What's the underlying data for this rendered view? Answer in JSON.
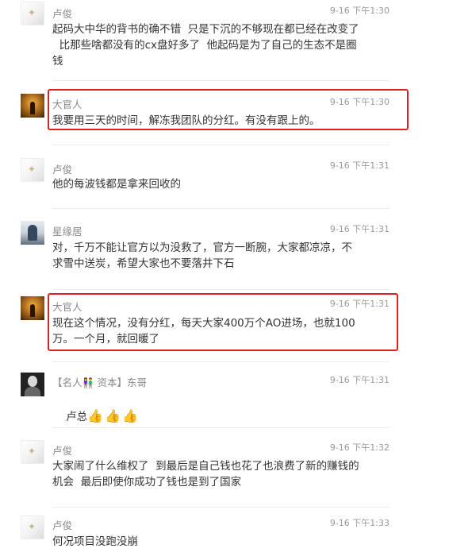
{
  "comments": [
    {
      "name": "卢俊",
      "time": "9-16 下午1:30",
      "lines": [
        "起码大中华的背书的确不错  只是下沉的不够现在都已经在改变了",
        "  比那些啥都没有的cx盘好多了  他起码是为了自己的生态不是圈",
        "钱"
      ]
    },
    {
      "name": "大官人",
      "time": "9-16 下午1:30",
      "lines": [
        "我要用三天的时间，解冻我团队的分红。有没有跟上的。"
      ]
    },
    {
      "name": "卢俊",
      "time": "9-16 下午1:31",
      "lines": [
        "他的每波钱都是拿来回收的"
      ]
    },
    {
      "name": "星缘居",
      "time": "9-16 下午1:31",
      "lines": [
        "对，千万不能让官方以为没救了，官方一断腕，大家都凉凉，不",
        "求雪中送炭，希望大家也不要落井下石"
      ]
    },
    {
      "name": "大官人",
      "time": "9-16 下午1:31",
      "lines": [
        "现在这个情况，没有分红，每天大家400万个AO进场，也就100",
        "万。一个月，就回暖了"
      ]
    },
    {
      "name_parts": {
        "prefix": "【名人",
        "kids": "👫",
        "mid": " 资本】",
        "suffix": "东哥"
      },
      "time": "9-16 下午1:31",
      "text": "卢总",
      "thumbs": [
        "👍",
        "👍",
        "👍"
      ]
    },
    {
      "name": "卢俊",
      "time": "9-16 下午1:32",
      "lines": [
        "大家闹了什么维权了  到最后是自己钱也花了也浪费了新的赚钱的",
        "机会  最后即使你成功了钱也是到了国家"
      ]
    },
    {
      "name": "卢俊",
      "time": "9-16 下午1:33",
      "lines": [
        "何况项目没跑没崩"
      ]
    }
  ],
  "highlight_color": "#e02020"
}
